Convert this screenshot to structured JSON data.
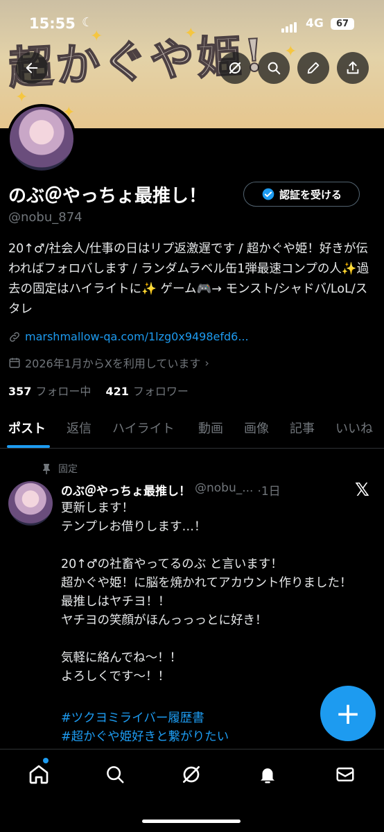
{
  "status_bar": {
    "time": "15:55",
    "network": "4G",
    "battery": "67"
  },
  "banner": {
    "title": "超かぐや姫!"
  },
  "profile": {
    "name": "のぶ＠やっちょ最推し！",
    "handle": "@nobu_874",
    "verify_label": "認証を受ける",
    "bio": "20↑♂/社会人/仕事の日はリプ返激遅です / 超かぐや姫！好きが伝わればフォロバします / ランダムラベル缶1弾最速コンプの人✨過去の固定はハイライトに✨ ゲーム🎮→ モンスト/シャドバ/LoL/スタレ",
    "link": "marshmallow-qa.com/1lzg0x9498efd6...",
    "joined": "2026年1月からXを利用しています",
    "following_count": "357",
    "following_label": "フォロー中",
    "followers_count": "421",
    "followers_label": "フォロワー"
  },
  "tabs": [
    "ポスト",
    "返信",
    "ハイライト",
    "動画",
    "画像",
    "記事",
    "いいね"
  ],
  "post": {
    "pinned_label": "固定",
    "author_name": "のぶ＠やっちょ最推し！",
    "author_handle": "@nobu_...",
    "time": "·1日",
    "body": "更新します！\nテンプレお借りします…！\n\n20↑♂の社畜やってるのぶ と言います！\n超かぐや姫！に脳を焼かれてアカウント作りました！\n最推しはヤチヨ！！\nヤチヨの笑顔がほんっっっとに好き！\n\n気軽に絡んでね〜！！\nよろしくです〜！！",
    "hashtags": [
      "#ツクヨミライバー履歴書",
      "#超かぐや姫好きと繋がりたい"
    ]
  },
  "fab": {
    "label": "+"
  },
  "colors": {
    "accent": "#1d9bf0",
    "background": "#000000",
    "muted": "#71767b"
  }
}
